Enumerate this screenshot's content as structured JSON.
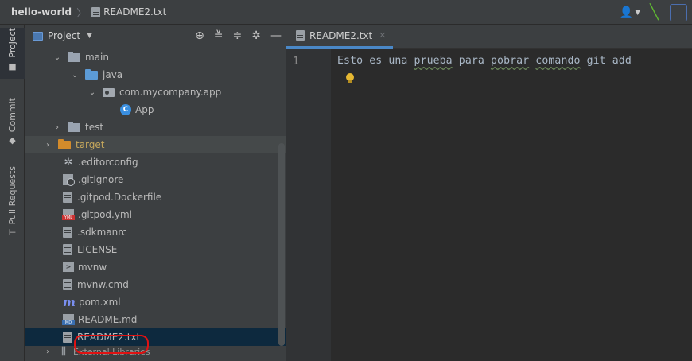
{
  "navbar": {
    "project": "hello-world",
    "file": "README2.txt"
  },
  "toolstrip": {
    "items": [
      "Project",
      "Commit",
      "Pull Requests"
    ]
  },
  "project_panel": {
    "title": "Project",
    "tree": [
      {
        "label": "main",
        "kind": "folder",
        "expanded": true
      },
      {
        "label": "java",
        "kind": "folder-blue",
        "expanded": true
      },
      {
        "label": "com.mycompany.app",
        "kind": "package",
        "expanded": true
      },
      {
        "label": "App",
        "kind": "class"
      },
      {
        "label": "test",
        "kind": "folder",
        "expanded": false
      },
      {
        "label": "target",
        "kind": "folder-orange",
        "expanded": false
      },
      {
        "label": ".editorconfig",
        "kind": "gear"
      },
      {
        "label": ".gitignore",
        "kind": "gitignore"
      },
      {
        "label": ".gitpod.Dockerfile",
        "kind": "text"
      },
      {
        "label": ".gitpod.yml",
        "kind": "yml"
      },
      {
        "label": ".sdkmanrc",
        "kind": "text"
      },
      {
        "label": "LICENSE",
        "kind": "text"
      },
      {
        "label": "mvnw",
        "kind": "mvnw"
      },
      {
        "label": "mvnw.cmd",
        "kind": "text"
      },
      {
        "label": "pom.xml",
        "kind": "maven"
      },
      {
        "label": "README.md",
        "kind": "md"
      },
      {
        "label": "README2.txt",
        "kind": "text",
        "selected": true
      },
      {
        "label": "External Libraries",
        "kind": "libs"
      }
    ]
  },
  "editor": {
    "tab_label": "README2.txt",
    "line_number": "1",
    "code_parts": [
      "sto es una ",
      "prueba",
      " para ",
      "pobrar",
      " ",
      "comando",
      " git add"
    ],
    "code_first_char": "E"
  },
  "colors": {
    "accent": "#4a88c7",
    "selection": "#0d293e",
    "highlight_circle": "#e01212"
  }
}
